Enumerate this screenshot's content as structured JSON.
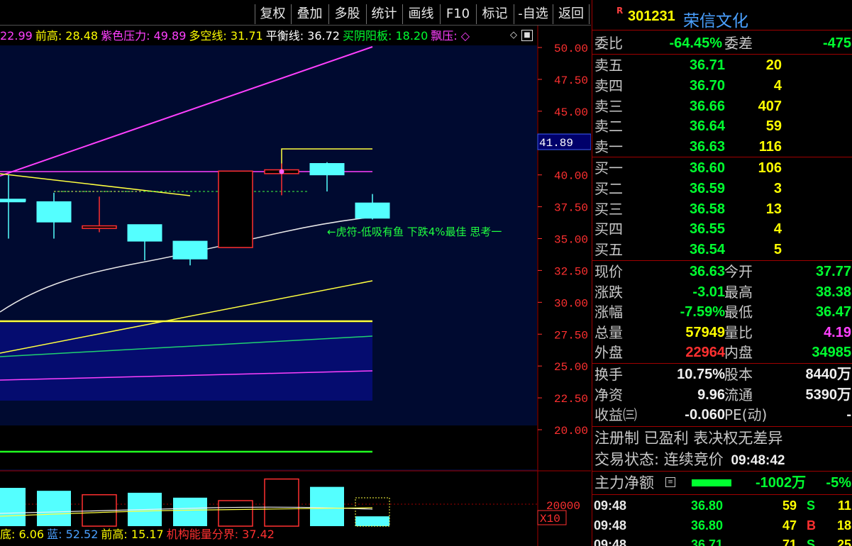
{
  "toolbar": {
    "buttons": [
      "复权",
      "叠加",
      "多股",
      "统计",
      "画线",
      "F10",
      "标记",
      "-自选",
      "返回"
    ]
  },
  "indicator_header": [
    {
      "text": "22.99",
      "color": "#ff40ff"
    },
    {
      "text": "前高: 28.48",
      "color": "#ffff00"
    },
    {
      "text": "紫色压力: 49.89",
      "color": "#ff40ff"
    },
    {
      "text": "多空线: 31.71",
      "color": "#ffff00"
    },
    {
      "text": "平衡线: 36.72",
      "color": "#ffffff"
    },
    {
      "text": "买阴阳板: 18.20",
      "color": "#00ff30"
    },
    {
      "text": "飘压: ◇",
      "color": "#ff40ff"
    }
  ],
  "chart_annotation": "←虎符-低吸有鱼 下跌4%最佳 思考一",
  "price_tag": "41.89",
  "y_axis": [
    "50.00",
    "47.50",
    "45.00",
    "40.00",
    "37.50",
    "35.00",
    "32.50",
    "30.00",
    "27.50",
    "25.00",
    "22.50",
    "20.00"
  ],
  "vol_axis": [
    "20000",
    "X10"
  ],
  "chart_data": {
    "type": "candlestick",
    "ylim": [
      18.5,
      51.0
    ],
    "candles": [
      {
        "o": 38.1,
        "h": 40.0,
        "l": 35.0,
        "c": 38.1,
        "color": "cyan"
      },
      {
        "o": 36.3,
        "h": 38.6,
        "l": 35.0,
        "c": 37.9,
        "color": "cyan"
      },
      {
        "o": 36.0,
        "h": 38.3,
        "l": 35.5,
        "c": 35.8,
        "color": "red"
      },
      {
        "o": 34.8,
        "h": 36.1,
        "l": 33.3,
        "c": 36.1,
        "color": "cyan"
      },
      {
        "o": 33.4,
        "h": 34.8,
        "l": 32.9,
        "c": 34.8,
        "color": "cyan"
      },
      {
        "o": 40.3,
        "h": 40.3,
        "l": 34.3,
        "c": 34.3,
        "color": "red"
      },
      {
        "o": 40.1,
        "h": 40.9,
        "l": 38.4,
        "c": 40.4,
        "color": "red"
      },
      {
        "o": 40.9,
        "h": 41.0,
        "l": 38.7,
        "c": 40.0,
        "color": "cyan"
      },
      {
        "o": 37.8,
        "h": 38.5,
        "l": 36.5,
        "c": 36.6,
        "color": "cyan"
      }
    ],
    "volumes": [
      {
        "v": 19500,
        "color": "cyan"
      },
      {
        "v": 18000,
        "color": "cyan"
      },
      {
        "v": 16000,
        "color": "red"
      },
      {
        "v": 17000,
        "color": "cyan"
      },
      {
        "v": 14500,
        "color": "cyan"
      },
      {
        "v": 13000,
        "color": "red"
      },
      {
        "v": 24000,
        "color": "red"
      },
      {
        "v": 20000,
        "color": "cyan"
      },
      {
        "v": 5000,
        "color": "cyan"
      }
    ]
  },
  "panel": {
    "code": "301231",
    "name": "荣信文化",
    "wei_bi": {
      "label": "委比",
      "value": "-64.45%",
      "label2": "委差",
      "value2": "-475"
    },
    "sells": [
      {
        "label": "卖五",
        "price": "36.71",
        "vol": "20"
      },
      {
        "label": "卖四",
        "price": "36.70",
        "vol": "4"
      },
      {
        "label": "卖三",
        "price": "36.66",
        "vol": "407"
      },
      {
        "label": "卖二",
        "price": "36.64",
        "vol": "59"
      },
      {
        "label": "卖一",
        "price": "36.63",
        "vol": "116"
      }
    ],
    "buys": [
      {
        "label": "买一",
        "price": "36.60",
        "vol": "106"
      },
      {
        "label": "买二",
        "price": "36.59",
        "vol": "3"
      },
      {
        "label": "买三",
        "price": "36.58",
        "vol": "13"
      },
      {
        "label": "买四",
        "price": "36.55",
        "vol": "4"
      },
      {
        "label": "买五",
        "price": "36.54",
        "vol": "5"
      }
    ],
    "quote": [
      {
        "l1": "现价",
        "v1": "36.63",
        "c1": "green",
        "l2": "今开",
        "v2": "37.77",
        "c2": "green"
      },
      {
        "l1": "涨跌",
        "v1": "-3.01",
        "c1": "green",
        "l2": "最高",
        "v2": "38.38",
        "c2": "green"
      },
      {
        "l1": "涨幅",
        "v1": "-7.59%",
        "c1": "green",
        "l2": "最低",
        "v2": "36.47",
        "c2": "green"
      },
      {
        "l1": "总量",
        "v1": "57949",
        "c1": "yellow",
        "l2": "量比",
        "v2": "4.19",
        "c2": "magenta"
      },
      {
        "l1": "外盘",
        "v1": "22964",
        "c1": "red",
        "l2": "内盘",
        "v2": "34985",
        "c2": "green"
      }
    ],
    "fund": [
      {
        "l1": "换手",
        "v1": "10.75%",
        "l2": "股本",
        "v2": "8440万"
      },
      {
        "l1": "净资",
        "v1": "9.96",
        "l2": "流通",
        "v2": "5390万"
      },
      {
        "l1": "收益㈢",
        "v1": "-0.060",
        "l2": "PE(动)",
        "v2": "-"
      }
    ],
    "reg_note": "注册制 已盈利 表决权无差异",
    "status_label": "交易状态: 连续竞价",
    "status_time": "09:48:42",
    "main_force": {
      "label": "主力净额",
      "value": "-1002万",
      "pct": "-5%"
    },
    "ticks": [
      {
        "t": "09:48",
        "p": "36.80",
        "q": "59",
        "s": "S",
        "n": "11"
      },
      {
        "t": "09:48",
        "p": "36.80",
        "q": "47",
        "s": "B",
        "n": "18"
      },
      {
        "t": "09:48",
        "p": "36.71",
        "q": "71",
        "s": "S",
        "n": "25"
      }
    ]
  },
  "vol_footer": [
    {
      "text": "底: 6.06",
      "color": "#ffff00"
    },
    {
      "text": "蓝: 52.52",
      "color": "#4aa0ff"
    },
    {
      "text": "前高: 15.17",
      "color": "#ffff00"
    },
    {
      "text": "机构能量分界: 37.42",
      "color": "#ff3030"
    }
  ],
  "colors": {
    "up": "#ff3030",
    "down": "#54ffff",
    "panel_bg": "#000000",
    "chart_fill": "#000833"
  }
}
